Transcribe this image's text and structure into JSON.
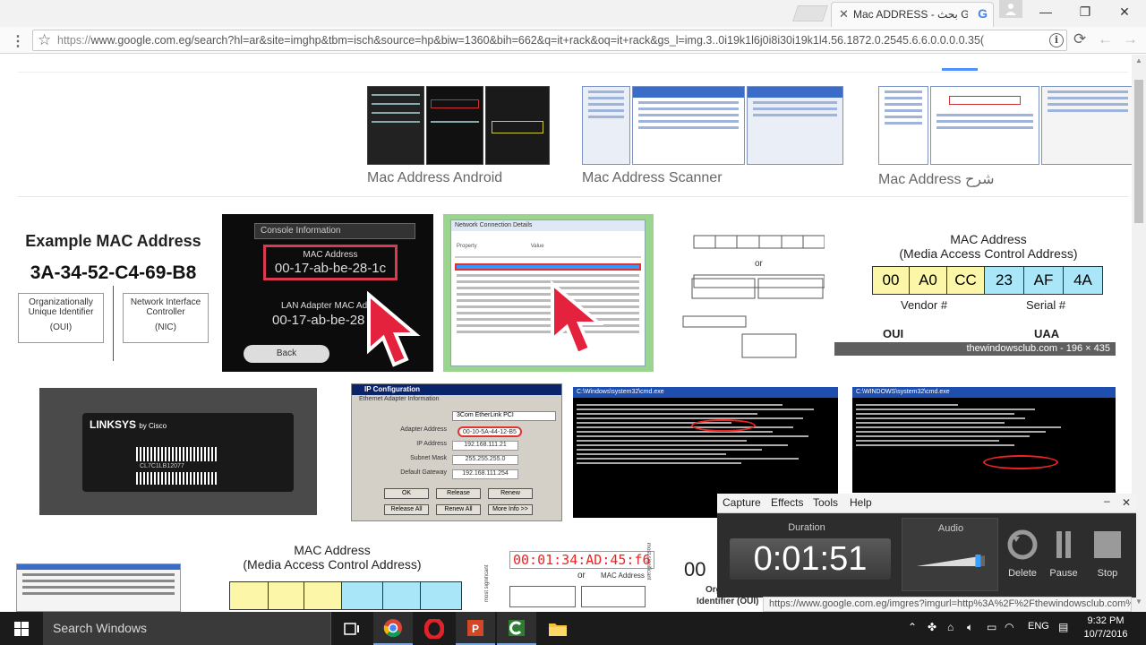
{
  "browser": {
    "tab": {
      "title": "Mac ADDRESS - بحث Google",
      "favicon": "G"
    },
    "url_prefix": "https://",
    "url_rest": "www.google.com.eg/search?hl=ar&site=imghp&tbm=isch&source=hp&biw=1360&bih=662&q=it+rack&oq=it+rack&gs_l=img.3..0i19k1l6j0i8i30i19k1l4.56.1872.0.2545.6.6.0.0.0.0.35("
  },
  "related": [
    {
      "label": "Mac Address Android"
    },
    {
      "label": "Mac Address Scanner"
    },
    {
      "label": "Mac Address شرح"
    }
  ],
  "results": {
    "example": {
      "title": "Example MAC Address",
      "mac": "3A-34-52-C4-69-B8",
      "left_label": "Organizationally Unique Identifier",
      "left_abbr": "(OUI)",
      "right_label": "Network Interface Controller",
      "right_abbr": "(NIC)"
    },
    "console": {
      "header": "Console Information",
      "mac_label": "MAC Address",
      "mac": "00-17-ab-be-28-1c",
      "lan_label": "LAN Adapter MAC Ad",
      "lan_mac": "00-17-ab-be-28",
      "back": "Back"
    },
    "netdetails": {
      "title": "Network Connection Details",
      "col1": "Property",
      "col2": "Value"
    },
    "bits": {
      "or": "or"
    },
    "windowsclub": {
      "title": "MAC Address",
      "subtitle": "(Media Access Control Address)",
      "octets": [
        "00",
        "A0",
        "CC",
        "23",
        "AF",
        "4A"
      ],
      "vendor": "Vendor #",
      "serial": "Serial #",
      "oui": "OUI",
      "uaa": "UAA",
      "caption": "thewindowsclub.com - 196 × 435"
    },
    "linksys": {
      "brand": "LINKSYS",
      "by": "by Cisco",
      "serial": "CL7C1LB12077"
    },
    "ipconfig": {
      "title": "IP Configuration",
      "tab_label": "Ethernet Adapter Information",
      "adapter": "3Com EtherLink PCI",
      "fields": [
        {
          "label": "Adapter Address",
          "value": "00-10-5A-44-12-B5"
        },
        {
          "label": "IP Address",
          "value": "192.168.111.21"
        },
        {
          "label": "Subnet Mask",
          "value": "255.255.255.0"
        },
        {
          "label": "Default Gateway",
          "value": "192.168.111.254"
        }
      ],
      "buttons": [
        "OK",
        "Release",
        "Renew",
        "Release All",
        "Renew All",
        "More Info >>"
      ]
    },
    "cmd1": {
      "title": "C:\\Windows\\system32\\cmd.exe"
    },
    "cmd2": {
      "title": "C:\\WINDOWS\\system32\\cmd.exe"
    },
    "bottom_mac": {
      "title": "MAC Address",
      "subtitle": "(Media Access Control Address)"
    },
    "bottom_hex": {
      "hex": "00:01:34:AD:45:f6",
      "or": "or",
      "mac_label": "MAC Address",
      "side": "most significant"
    },
    "partial": {
      "text": "00",
      "sub1": "Organiz",
      "sub2": "Identifier (OUI)"
    }
  },
  "capture": {
    "menu": [
      "Capture",
      "Effects",
      "Tools",
      "Help"
    ],
    "duration_label": "Duration",
    "duration": "0:01:51",
    "audio_label": "Audio",
    "audio_level": 0.9,
    "buttons": [
      "Delete",
      "Pause",
      "Stop"
    ]
  },
  "status_url": "https://www.google.com.eg/imgres?imgurl=http%3A%2F%2Fthewindowsclub.com%2Fwp-content",
  "taskbar": {
    "search_placeholder": "Search Windows",
    "apps": [
      "task-view-icon",
      "chrome-icon",
      "opera-icon",
      "powerpoint-icon",
      "camtasia-icon",
      "file-explorer-icon"
    ],
    "lang": "ENG",
    "time": "9:32 PM",
    "date": "10/7/2016"
  }
}
